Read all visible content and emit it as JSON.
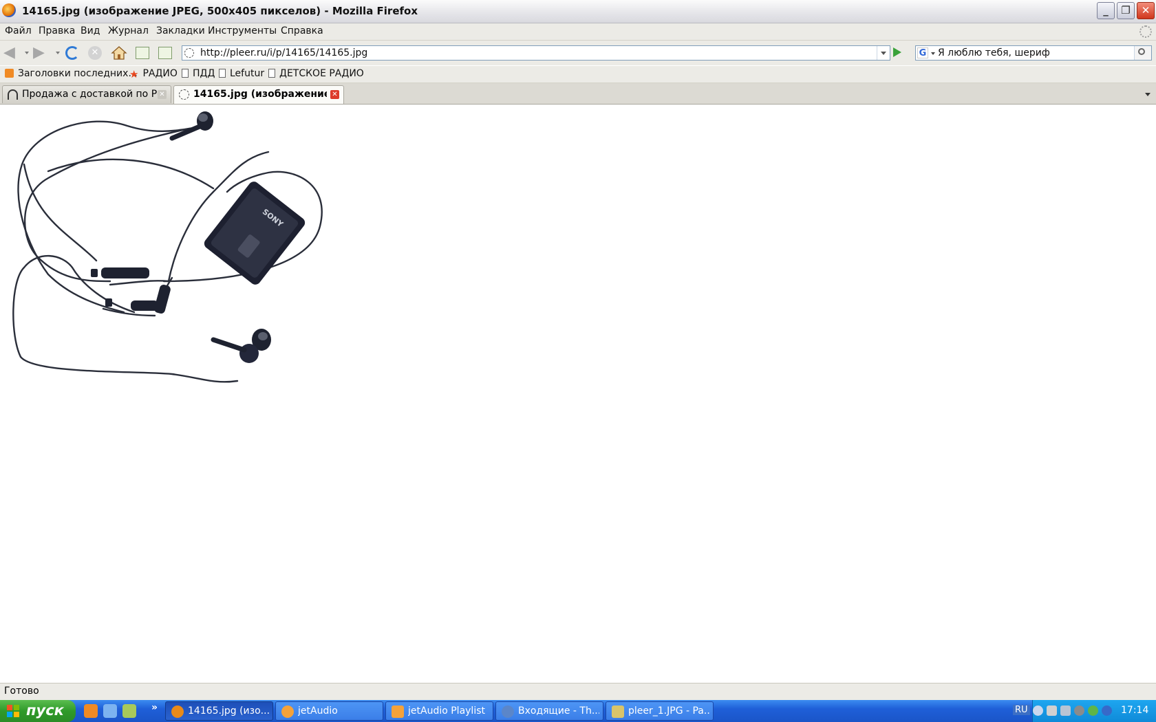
{
  "window": {
    "title": "14165.jpg (изображение JPEG, 500x405 пикселов) - Mozilla Firefox"
  },
  "menu": {
    "items": [
      "Файл",
      "Правка",
      "Вид",
      "Журнал",
      "Закладки",
      "Инструменты",
      "Справка"
    ]
  },
  "navigation": {
    "url": "http://pleer.ru/i/p/14165/14165.jpg",
    "search_query": "Я люблю тебя, шериф",
    "search_engine_icon": "G"
  },
  "bookmarks": {
    "items": [
      {
        "label": "Заголовки последних...",
        "icon": "rss-icon"
      },
      {
        "label": "РАДИО",
        "icon": "star-icon"
      },
      {
        "label": "ПДД",
        "icon": "page-icon"
      },
      {
        "label": "Lefutur",
        "icon": "page-icon"
      },
      {
        "label": "ДЕТСКОЕ РАДИО",
        "icon": "page-icon"
      }
    ]
  },
  "tabs": [
    {
      "label": "Продажа с доставкой по Ро...",
      "icon": "headphones-icon",
      "active": false
    },
    {
      "label": "14165.jpg (изображение ...",
      "icon": "image-icon",
      "active": true
    }
  ],
  "content": {
    "image_label": "SONY"
  },
  "status": {
    "text": "Готово"
  },
  "taskbar": {
    "start_label": "пуск",
    "quick_launch_more": "»",
    "tasks": [
      {
        "label": "14165.jpg (изо...",
        "icon": "firefox-icon",
        "active": true
      },
      {
        "label": "jetAudio",
        "icon": "jetaudio-icon",
        "active": false
      },
      {
        "label": "jetAudio Playlist",
        "icon": "jetaudio-playlist-icon",
        "active": false
      },
      {
        "label": "Входящие - Th...",
        "icon": "thunderbird-icon",
        "active": false
      },
      {
        "label": "pleer_1.JPG - Pa...",
        "icon": "paint-icon",
        "active": false
      }
    ],
    "language": "RU",
    "clock": "17:14"
  },
  "colors": {
    "taskbar_blue": "#1f5fd8",
    "start_green": "#2f9a2a",
    "close_red": "#d0361c",
    "chrome_bg": "#ecebe6"
  }
}
